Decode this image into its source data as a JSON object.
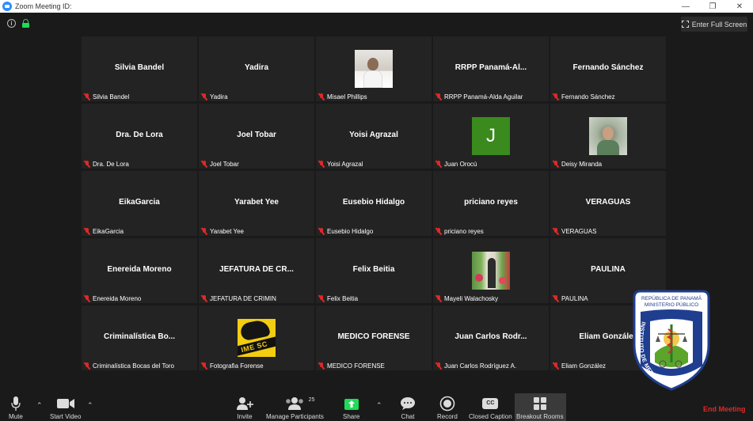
{
  "window": {
    "title": "Zoom Meeting ID:",
    "controls": [
      "minimize-icon",
      "restore-icon",
      "close-icon"
    ]
  },
  "topbar": {
    "fullscreen_label": "Enter Full Screen"
  },
  "participants": [
    {
      "display": "Silvia Bandel",
      "name": "Silvia Bandel",
      "media": "text",
      "muted": true
    },
    {
      "display": "Yadira",
      "name": "Yadira",
      "media": "text",
      "muted": true
    },
    {
      "display": "",
      "name": "Misael Phillips",
      "media": "photo-misael",
      "muted": true
    },
    {
      "display": "RRPP  Panamá-Al...",
      "name": "RRPP Panamá-Alda Aguilar",
      "media": "text",
      "muted": true
    },
    {
      "display": "Fernando Sánchez",
      "name": "Fernando Sánchez",
      "media": "text",
      "muted": true
    },
    {
      "display": "Dra. De Lora",
      "name": "Dra. De Lora",
      "media": "text",
      "muted": true
    },
    {
      "display": "Joel Tobar",
      "name": "Joel Tobar",
      "media": "text",
      "muted": true
    },
    {
      "display": "Yoisi Agrazal",
      "name": "Yoisi Agrazal",
      "media": "text",
      "muted": true
    },
    {
      "display": "J",
      "name": "Juan Orocú",
      "media": "avatar-j",
      "muted": true
    },
    {
      "display": "",
      "name": "Deisy Miranda",
      "media": "photo-deisy",
      "muted": true
    },
    {
      "display": "EikaGarcia",
      "name": "EikaGarcia",
      "media": "text",
      "muted": true
    },
    {
      "display": "Yarabet Yee",
      "name": "Yarabet Yee",
      "media": "text",
      "muted": true
    },
    {
      "display": "Eusebio Hidalgo",
      "name": "Eusebio Hidalgo",
      "media": "text",
      "muted": true
    },
    {
      "display": "priciano reyes",
      "name": "priciano reyes",
      "media": "text",
      "muted": true
    },
    {
      "display": "VERAGUAS",
      "name": "VERAGUAS",
      "media": "text",
      "muted": true
    },
    {
      "display": "Enereida Moreno",
      "name": "Enereida Moreno",
      "media": "text",
      "muted": true
    },
    {
      "display": "JEFATURA  DE  CR...",
      "name": "JEFATURA DE CRIMIN",
      "media": "text",
      "muted": true
    },
    {
      "display": "Felix Beitia",
      "name": "Felix Beitia",
      "media": "text",
      "muted": true
    },
    {
      "display": "",
      "name": "Mayeli Walachosky",
      "media": "photo-mayeli",
      "muted": true
    },
    {
      "display": "PAULINA",
      "name": "PAULINA",
      "media": "text",
      "muted": true
    },
    {
      "display": "Criminalística  Bo...",
      "name": "Criminalística Bocas del Toro",
      "media": "text",
      "muted": true
    },
    {
      "display": "",
      "name": "Fotografia Forense",
      "media": "photo-fotografia",
      "photo_text": "IME SC",
      "muted": true
    },
    {
      "display": "MEDICO FORENSE",
      "name": "MEDICO FORENSE",
      "media": "text",
      "muted": true
    },
    {
      "display": "Juan  Carlos  Rodr...",
      "name": "Juan Carlos Rodríguez A.",
      "media": "text",
      "muted": true
    },
    {
      "display": "Eliam  González",
      "name": "Eliam González",
      "media": "text",
      "muted": true
    }
  ],
  "watermark": {
    "line1": "REPÚBLICA DE PANAMÁ",
    "line2": "MINISTERIO PÚBLICO",
    "arc_text": "INSTITUTO DE MEDICINA LEGAL Y CIENCIAS FORENSES"
  },
  "toolbar": {
    "mute": "Mute",
    "start_video": "Start Video",
    "invite": "Invite",
    "manage_participants": "Manage Participants",
    "participants_count": "25",
    "share": "Share",
    "chat": "Chat",
    "record": "Record",
    "closed_caption": "Closed Caption",
    "cc_badge": "CC",
    "breakout_rooms": "Breakout Rooms",
    "end_meeting": "End Meeting"
  },
  "colors": {
    "background": "#1a1a1a",
    "tile": "#232323",
    "muted_red": "#e02828",
    "share_green": "#23d959",
    "avatar_green": "#3a8a1d",
    "zoom_blue": "#2d8cff"
  }
}
